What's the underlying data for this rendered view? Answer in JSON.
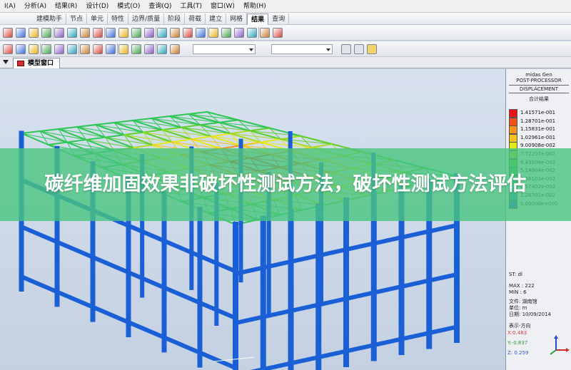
{
  "menu": [
    "I(A)",
    "分析(A)",
    "结果(R)",
    "设计(D)",
    "模式(O)",
    "查询(Q)",
    "工具(T)",
    "窗口(W)",
    "帮助(H)"
  ],
  "ribbon_tabs": [
    {
      "label": "建模助手",
      "active": false
    },
    {
      "label": "节点",
      "active": false
    },
    {
      "label": "单元",
      "active": false
    },
    {
      "label": "特性",
      "active": false
    },
    {
      "label": "边界/质量",
      "active": false
    },
    {
      "label": "阶段",
      "active": false
    },
    {
      "label": "荷载",
      "active": false
    },
    {
      "label": "建立",
      "active": false
    },
    {
      "label": "网格",
      "active": false
    },
    {
      "label": "结果",
      "active": true
    },
    {
      "label": "查询",
      "active": false
    }
  ],
  "document_tab": {
    "label": "模型窗口"
  },
  "legend": {
    "header": [
      "midas Gen",
      "POST-PROCESSOR",
      "DISPLACEMENT"
    ],
    "subheader": "合计结果",
    "entries": [
      {
        "value": "1.41571e-001",
        "color": "#e8141c"
      },
      {
        "value": "1.28701e-001",
        "color": "#f0521a"
      },
      {
        "value": "1.15831e-001",
        "color": "#f7931c"
      },
      {
        "value": "1.02961e-001",
        "color": "#f5c21b"
      },
      {
        "value": "9.00908e-002",
        "color": "#e6e81e"
      },
      {
        "value": "7.72207e-002",
        "color": "#a9dc23"
      },
      {
        "value": "6.43506e-002",
        "color": "#5fd02a"
      },
      {
        "value": "5.14804e-002",
        "color": "#2ec655"
      },
      {
        "value": "3.86103e-002",
        "color": "#22c08f"
      },
      {
        "value": "2.57402e-002",
        "color": "#1eb3b6"
      },
      {
        "value": "1.28701e-002",
        "color": "#2a8fd4"
      },
      {
        "value": "0.00000e+000",
        "color": "#1f5ad9"
      }
    ],
    "info": [
      "ST: dl",
      "MAX : 222",
      "MIN : 6",
      "文件: 湖南馆",
      "单位: m",
      "日期: 10/09/2014",
      "表示-方向"
    ],
    "coords": [
      {
        "text": "X:0.483",
        "color": "#d23b3b"
      },
      {
        "text": "Y:-0.837",
        "color": "#2d9b3a"
      },
      {
        "text": "Z: 0.259",
        "color": "#3a56c8"
      }
    ]
  },
  "banner": {
    "title": "碳纤维加固效果非破坏性测试方法，破坏性测试方法评估"
  },
  "colors": {
    "frame": "#1b5fd6",
    "roof_high": "#e8141c",
    "banner": "#48c47e"
  }
}
